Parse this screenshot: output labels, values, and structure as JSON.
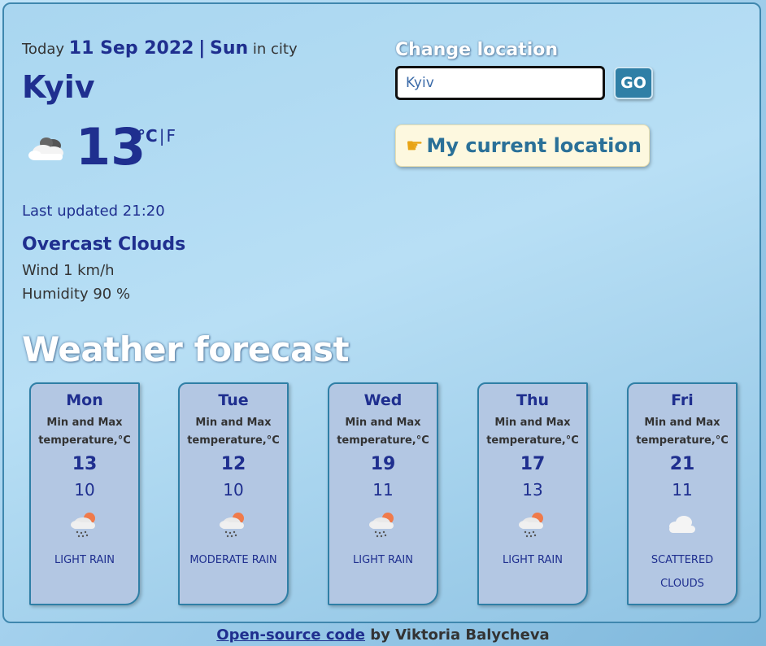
{
  "current": {
    "today_prefix": "Today",
    "date": "11 Sep 2022",
    "separator": "|",
    "day": "Sun",
    "in_city": "in city",
    "city": "Kyiv",
    "icon": "overcast-cloud-icon",
    "temperature": "13",
    "unit_c": "°C",
    "unit_sep": "|",
    "unit_f": "F",
    "last_updated": "Last updated 21:20",
    "description": "Overcast Clouds",
    "wind": "Wind 1 km/h",
    "humidity": "Humidity 90 %"
  },
  "search": {
    "label": "Change location",
    "value": "Kyiv",
    "go_label": "GO",
    "current_location_label": "My current location",
    "current_location_icon": "pointing-hand-icon"
  },
  "forecast": {
    "title": "Weather forecast",
    "days": [
      {
        "day": "Mon",
        "minmax_label": "Min and Max temperature,°C",
        "max": "13",
        "min": "10",
        "icon": "rain-cloud-sun-icon",
        "condition": "LIGHT RAIN"
      },
      {
        "day": "Tue",
        "minmax_label": "Min and Max temperature,°C",
        "max": "12",
        "min": "10",
        "icon": "rain-cloud-sun-icon",
        "condition": "MODERATE RAIN"
      },
      {
        "day": "Wed",
        "minmax_label": "Min and Max temperature,°C",
        "max": "19",
        "min": "11",
        "icon": "rain-cloud-sun-icon",
        "condition": "LIGHT RAIN"
      },
      {
        "day": "Thu",
        "minmax_label": "Min and Max temperature,°C",
        "max": "17",
        "min": "13",
        "icon": "rain-cloud-sun-icon",
        "condition": "LIGHT RAIN"
      },
      {
        "day": "Fri",
        "minmax_label": "Min and Max temperature,°C",
        "max": "21",
        "min": "11",
        "icon": "cloud-icon",
        "condition": "SCATTERED CLOUDS"
      }
    ]
  },
  "footer": {
    "link_text": "Open-source code",
    "by_text": " by Viktoria Balycheva"
  },
  "colors": {
    "accent_dark_blue": "#1f2f8f",
    "button_blue": "#2f7fa6",
    "card_bg": "#b3c7e3",
    "location_button_bg": "#fdf8df"
  }
}
